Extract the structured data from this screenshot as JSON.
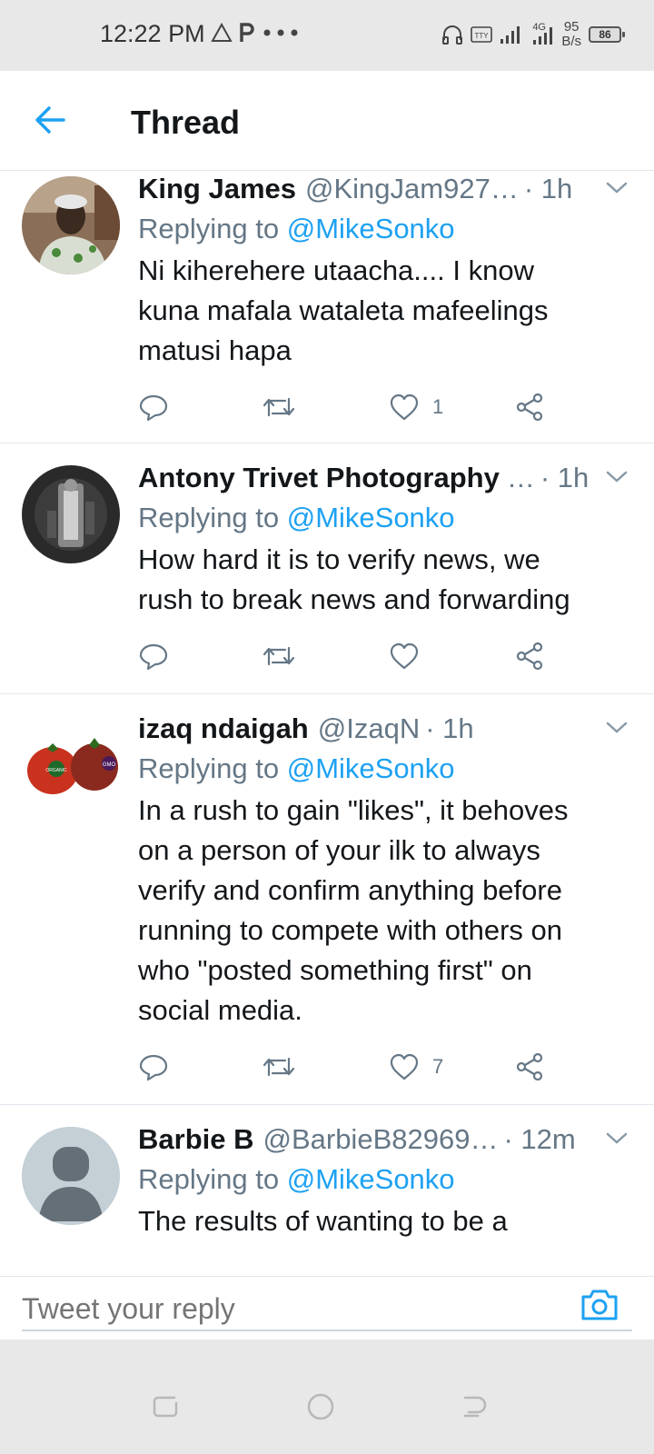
{
  "status_bar": {
    "time": "12:22 PM",
    "net_speed_value": "95",
    "net_speed_unit": "B/s",
    "network_type": "4G",
    "battery": "86"
  },
  "header": {
    "title": "Thread"
  },
  "tweets": [
    {
      "name": "King James",
      "handle": "@KingJam927…",
      "time": "· 1h",
      "replying_prefix": "Replying to",
      "replying_to": "@MikeSonko",
      "text_lines": [
        "Ni kiherehere utaacha.... I know",
        "kuna mafala wataleta mafeelings",
        "matusi  hapa"
      ],
      "like_count": "1"
    },
    {
      "name": "Antony Trivet Photography",
      "handle": "…",
      "time": "· 1h",
      "replying_prefix": "Replying to",
      "replying_to": "@MikeSonko",
      "text_lines": [
        "How hard it is to verify news, we",
        "rush to break news and forwarding"
      ],
      "like_count": ""
    },
    {
      "name": "izaq ndaigah",
      "handle": "@IzaqN",
      "time": "· 1h",
      "replying_prefix": "Replying to",
      "replying_to": "@MikeSonko",
      "text_lines": [
        "In a rush to gain \"likes\", it behoves",
        "on a person of your ilk to always",
        "verify and confirm anything before",
        "running to compete with others on",
        "who \"posted something first\" on",
        "social media."
      ],
      "like_count": "7",
      "avatar_label_1": "ORGANIC",
      "avatar_label_2": "GMO"
    },
    {
      "name": "Barbie B",
      "handle": "@BarbieB82969…",
      "time": "· 12m",
      "replying_prefix": "Replying to",
      "replying_to": "@MikeSonko",
      "text_lines": [
        "The results of wanting to be a"
      ],
      "like_count": ""
    }
  ],
  "reply_bar": {
    "placeholder": "Tweet your reply"
  },
  "colors": {
    "accent": "#1da1f2",
    "secondary_text": "#657786",
    "primary_text": "#14171a",
    "divider": "#e1e8ed"
  },
  "icons": [
    "back-arrow-icon",
    "chevron-down-icon",
    "reply-icon",
    "retweet-icon",
    "like-icon",
    "share-icon",
    "camera-icon"
  ]
}
